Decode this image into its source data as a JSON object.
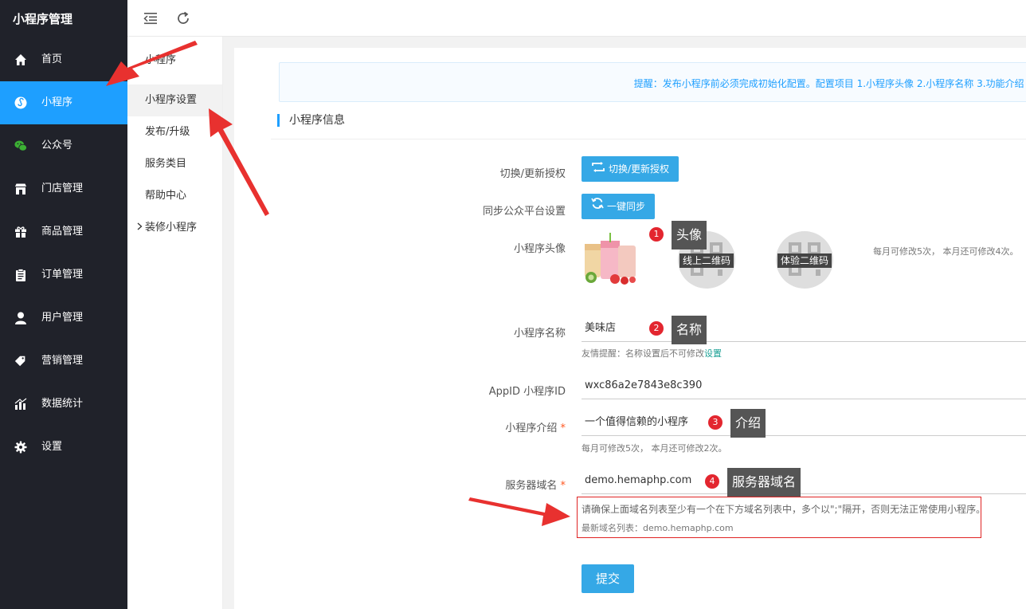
{
  "sidebar": {
    "brand": "小程序管理",
    "items": [
      {
        "label": "首页",
        "icon": "home-icon"
      },
      {
        "label": "小程序",
        "icon": "miniprogram-icon",
        "active": true
      },
      {
        "label": "公众号",
        "icon": "wechat-icon"
      },
      {
        "label": "门店管理",
        "icon": "store-icon"
      },
      {
        "label": "商品管理",
        "icon": "gift-icon"
      },
      {
        "label": "订单管理",
        "icon": "clipboard-icon"
      },
      {
        "label": "用户管理",
        "icon": "user-icon"
      },
      {
        "label": "营销管理",
        "icon": "tag-icon"
      },
      {
        "label": "数据统计",
        "icon": "chart-icon"
      },
      {
        "label": "设置",
        "icon": "gear-icon"
      }
    ],
    "active_color": "#1e9fff",
    "bg_color": "#20222a"
  },
  "topbar": {
    "icons": [
      "collapse-menu-icon",
      "refresh-icon"
    ]
  },
  "subnav": {
    "title": "小程序",
    "items": [
      "小程序设置",
      "发布/升级",
      "服务类目",
      "帮助中心",
      "装修小程序"
    ]
  },
  "notice": "提醒：发布小程序前必须完成初始化配置。配置项目 1.小程序头像 2.小程序名称 3.功能介绍 4",
  "section_title": "小程序信息",
  "form": {
    "auth": {
      "label": "切换/更新授权",
      "button": "切换/更新授权"
    },
    "sync": {
      "label": "同步公众平台设置",
      "button": "一键同步"
    },
    "avatar": {
      "label": "小程序头像",
      "qr_online": "线上二维码",
      "qr_trial": "体验二维码",
      "limit_note": "每月可修改5次， 本月还可修改4次。"
    },
    "name": {
      "label": "小程序名称",
      "value": "美味店",
      "hint": "友情提醒：名称设置后不可修改",
      "hint_link": "设置"
    },
    "appid": {
      "label": "AppID 小程序ID",
      "value": "wxc86a2e7843e8c390"
    },
    "intro": {
      "label": "小程序介绍",
      "required": "*",
      "value": "一个值得信赖的小程序",
      "hint": "每月可修改5次， 本月还可修改2次。"
    },
    "domain": {
      "label": "服务器域名",
      "required": "*",
      "value": "demo.hemaphp.com",
      "warn": "请确保上面域名列表至少有一个在下方域名列表中，多个以\";\"隔开，否则无法正常使用小程序。",
      "latest": "最新域名列表：demo.hemaphp.com"
    },
    "submit": "提交"
  },
  "annotations": [
    {
      "num": "1",
      "text": "头像"
    },
    {
      "num": "2",
      "text": "名称"
    },
    {
      "num": "3",
      "text": "介绍"
    },
    {
      "num": "4",
      "text": "服务器域名"
    }
  ],
  "colors": {
    "accent": "#1e9fff",
    "button": "#35a8e6",
    "arrow": "#e8312f",
    "badge": "#e3262f"
  }
}
